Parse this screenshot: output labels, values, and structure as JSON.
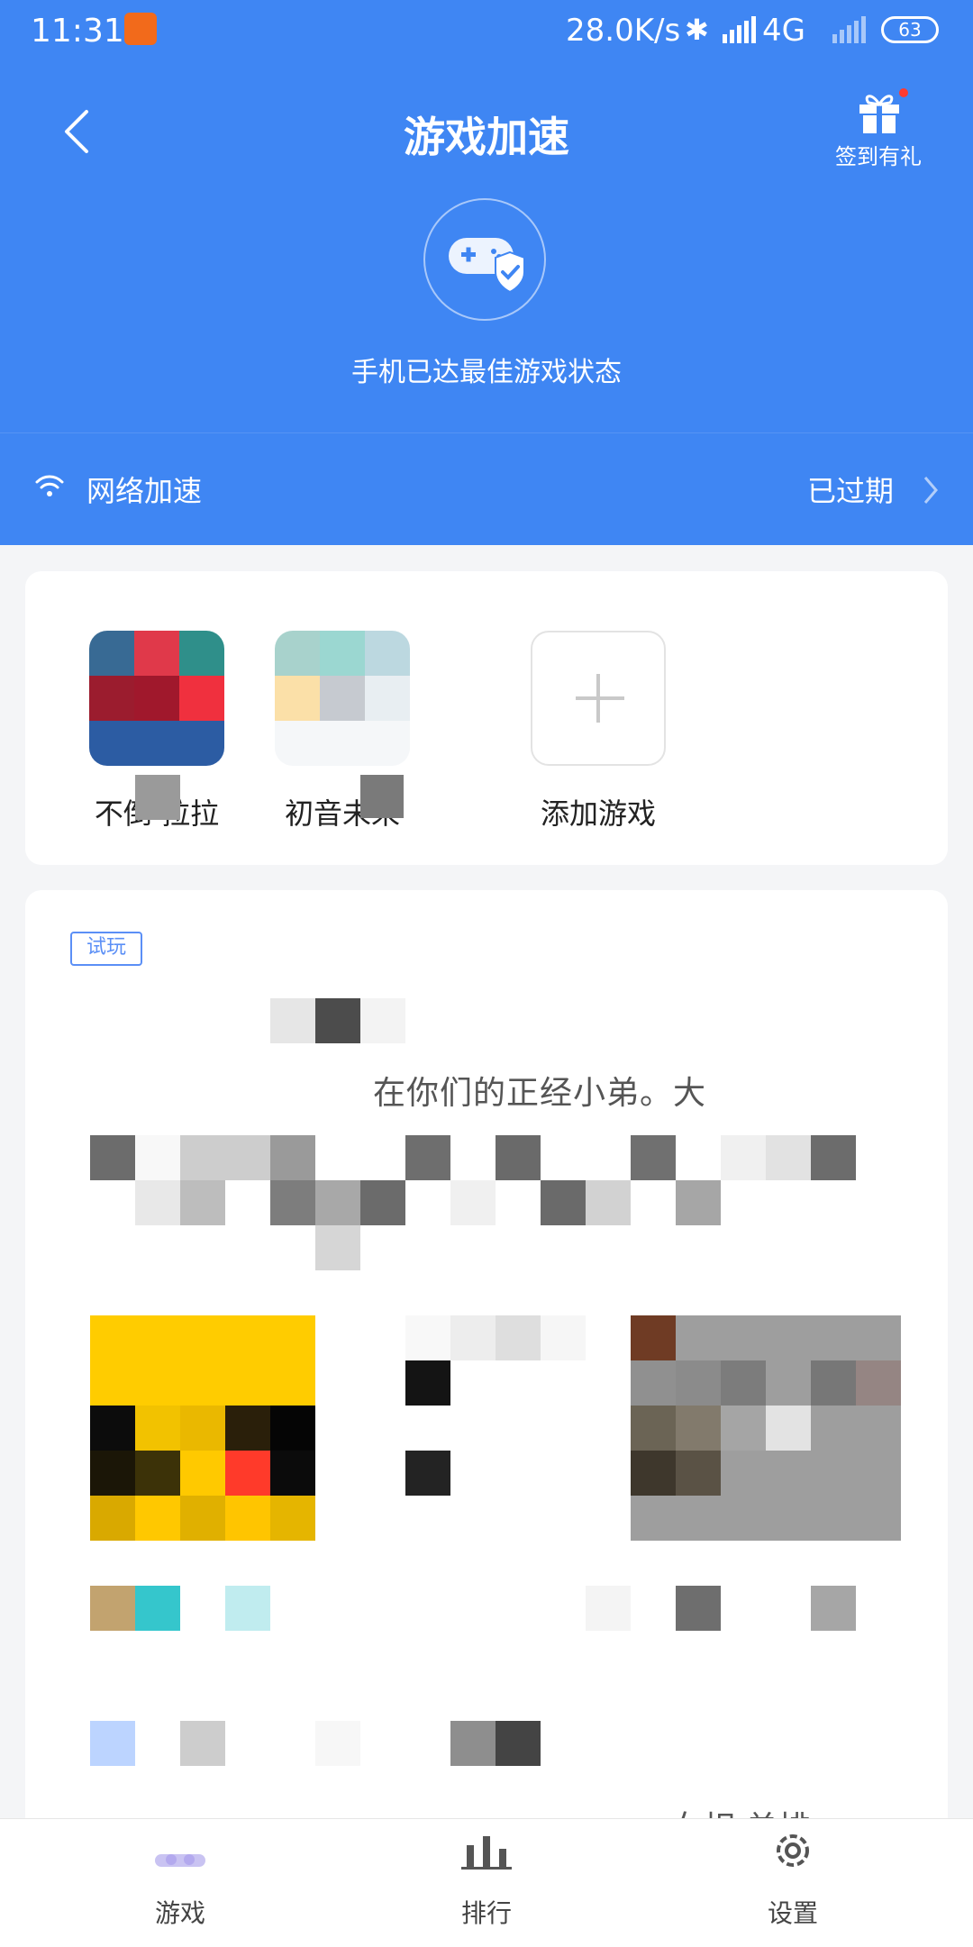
{
  "status_bar": {
    "time": "11:31",
    "network_speed": "28.0K/s",
    "network_type": "4G",
    "battery": "63"
  },
  "header": {
    "title": "游戏加速",
    "gift_label": "签到有礼",
    "status_message": "手机已达最佳游戏状态"
  },
  "network_accel": {
    "label": "网络加速",
    "status": "已过期"
  },
  "games": [
    {
      "label": "不倒    拉拉"
    },
    {
      "label": "初音未来"
    },
    {
      "label": "添加游戏"
    }
  ],
  "feed": {
    "tag": "试玩",
    "text_line1": "在你们的正经小弟。大",
    "text_line2": "女相 单排"
  },
  "bottom_nav": [
    {
      "label": "游戏"
    },
    {
      "label": "排行"
    },
    {
      "label": "设置"
    }
  ],
  "colors": {
    "primary": "#3f86f3",
    "background": "#f4f5f7",
    "card": "#ffffff"
  }
}
